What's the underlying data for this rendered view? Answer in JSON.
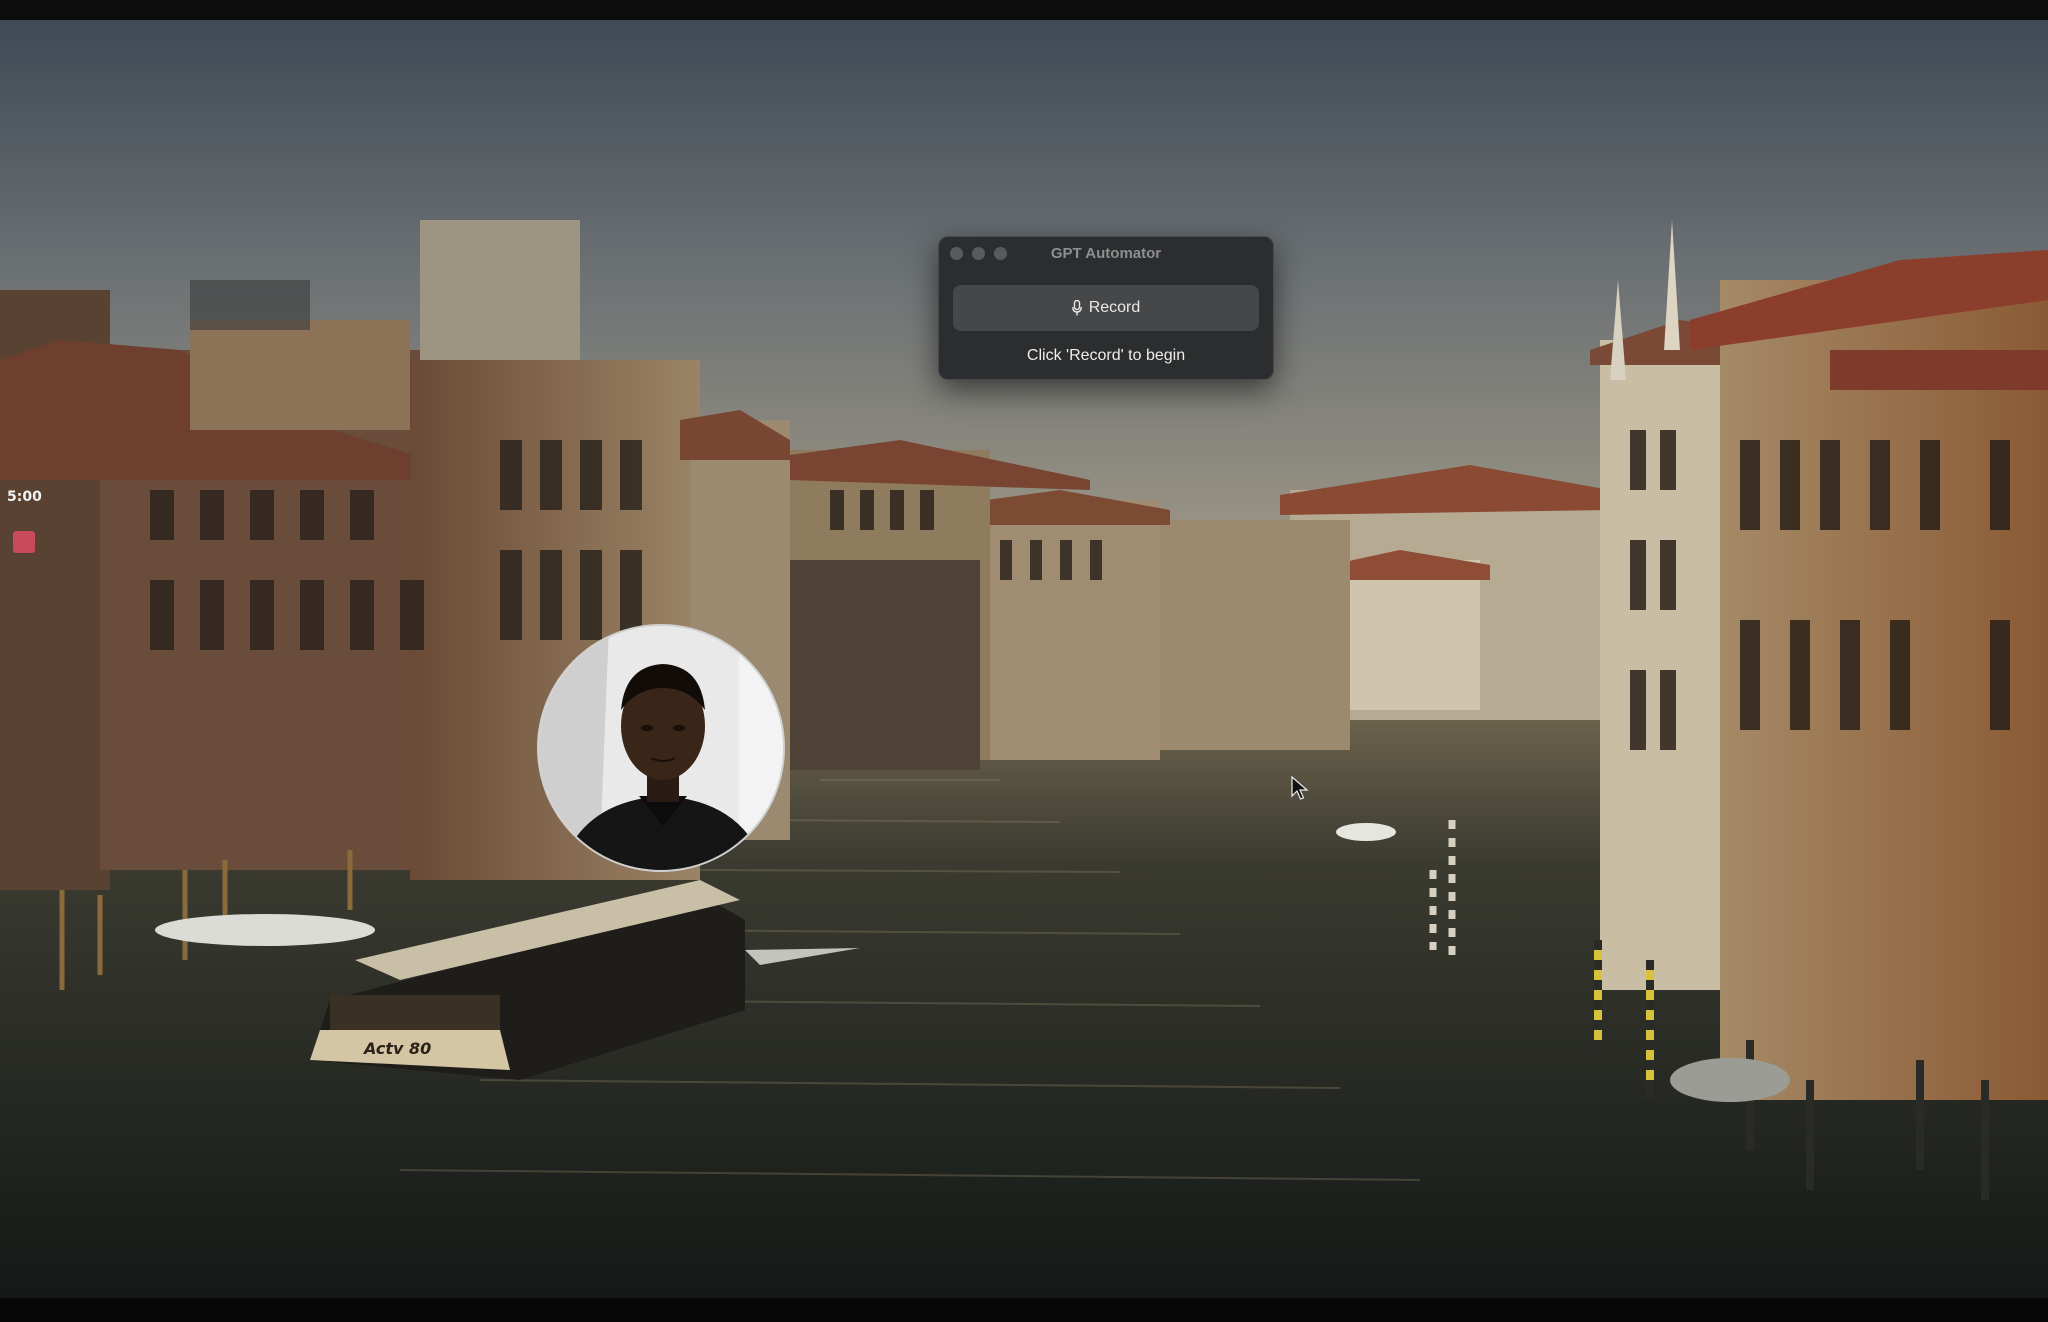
{
  "app_window": {
    "title": "GPT Automator",
    "record_button_label": "Record",
    "hint_text": "Click 'Record' to begin"
  },
  "recording_widget": {
    "timer": "5:00"
  },
  "background": {
    "boat_label": "Actv 80"
  },
  "icons": {
    "record": "microphone-icon",
    "stop": "stop-square-icon",
    "pointer": "mouse-pointer-icon"
  },
  "colors": {
    "window_bg": "#2c2d2e",
    "button_bg": "#464749",
    "stop_red": "#c94a5a"
  }
}
